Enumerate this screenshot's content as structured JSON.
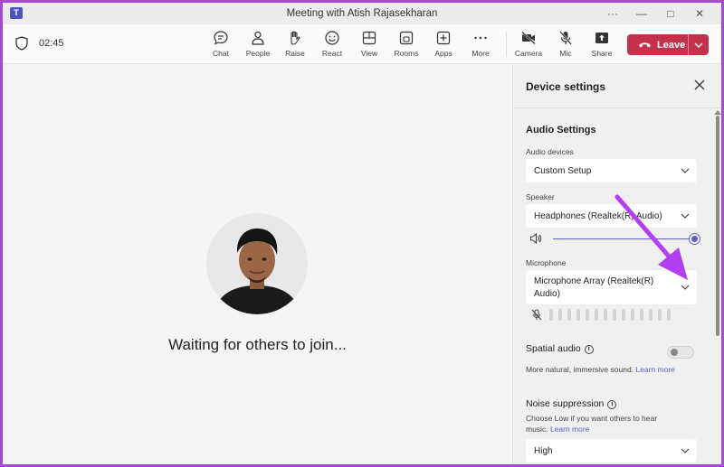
{
  "window": {
    "title": "Meeting with Atish Rajasekharan",
    "app_icon": "T"
  },
  "toolbar": {
    "timer": "02:45",
    "buttons": [
      {
        "label": "Chat",
        "icon": "chat-icon"
      },
      {
        "label": "People",
        "icon": "people-icon"
      },
      {
        "label": "Raise",
        "icon": "raise-hand-icon"
      },
      {
        "label": "React",
        "icon": "react-icon"
      },
      {
        "label": "View",
        "icon": "view-icon"
      },
      {
        "label": "Rooms",
        "icon": "rooms-icon"
      },
      {
        "label": "Apps",
        "icon": "apps-icon"
      },
      {
        "label": "More",
        "icon": "more-icon"
      },
      {
        "label": "Camera",
        "icon": "camera-off-icon"
      },
      {
        "label": "Mic",
        "icon": "mic-off-icon"
      },
      {
        "label": "Share",
        "icon": "share-icon"
      }
    ],
    "leave_label": "Leave",
    "leave_color": "#c4314b"
  },
  "stage": {
    "waiting_text": "Waiting for others to join..."
  },
  "panel": {
    "title": "Device settings",
    "audio_settings_title": "Audio Settings",
    "audio_devices_label": "Audio devices",
    "audio_devices_value": "Custom Setup",
    "speaker_label": "Speaker",
    "speaker_value": "Headphones (Realtek(R) Audio)",
    "speaker_volume": 1.0,
    "microphone_label": "Microphone",
    "microphone_value": "Microphone Array (Realtek(R) Audio)",
    "spatial_audio_label": "Spatial audio",
    "spatial_audio_on": false,
    "spatial_audio_desc": "More natural, immersive sound.",
    "learn_more": "Learn more",
    "noise_suppression_label": "Noise suppression",
    "noise_suppression_desc": "Choose Low if you want others to hear music.",
    "noise_suppression_value": "High",
    "accent_color": "#5b5fc7"
  },
  "annotation": {
    "arrow_color": "#b23ff0"
  }
}
